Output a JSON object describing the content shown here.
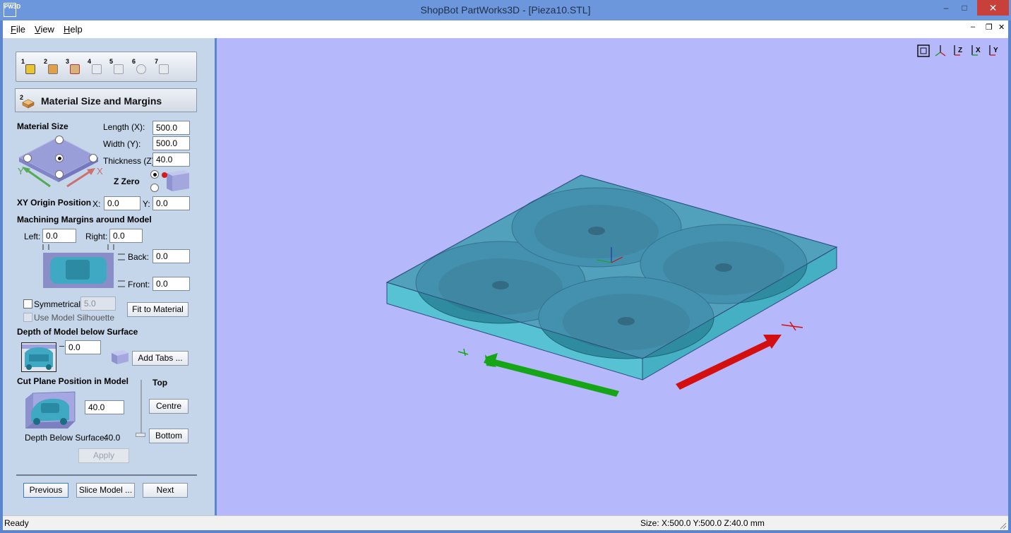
{
  "window": {
    "app_icon_text": "PW3D",
    "title": "ShopBot PartWorks3D - [Pieza10.STL]"
  },
  "menu": {
    "items": [
      {
        "label": "File"
      },
      {
        "label": "View"
      },
      {
        "label": "Help"
      }
    ]
  },
  "toolbar": {
    "steps": [
      {
        "number": "1",
        "icon": "import-model-icon"
      },
      {
        "number": "2",
        "icon": "material-size-icon"
      },
      {
        "number": "3",
        "icon": "roughing-icon"
      },
      {
        "number": "4",
        "icon": "finishing-icon"
      },
      {
        "number": "5",
        "icon": "cutout-icon"
      },
      {
        "number": "6",
        "icon": "preview-icon"
      },
      {
        "number": "7",
        "icon": "save-toolpath-icon"
      }
    ]
  },
  "section": {
    "step_number": "2",
    "title": "Material Size and Margins"
  },
  "material_size": {
    "heading": "Material Size",
    "axis_x": "X",
    "axis_y": "Y",
    "length_label": "Length (X):",
    "length_value": "500.0",
    "width_label": "Width (Y):",
    "width_value": "500.0",
    "thickness_label": "Thickness (Z):",
    "thickness_value": "40.0",
    "z_zero_label": "Z Zero"
  },
  "xy_origin": {
    "heading": "XY Origin Position",
    "x_label": "X:",
    "x_value": "0.0",
    "y_label": "Y:",
    "y_value": "0.0"
  },
  "margins": {
    "heading": "Machining Margins around Model",
    "left_label": "Left:",
    "left_value": "0.0",
    "right_label": "Right:",
    "right_value": "0.0",
    "back_label": "Back:",
    "back_value": "0.0",
    "front_label": "Front:",
    "front_value": "0.0",
    "symmetrical_label": "Symmetrical",
    "symmetrical_value": "5.0",
    "silhouette_label": "Use Model Silhouette",
    "fit_button": "Fit to Material"
  },
  "depth": {
    "heading": "Depth of Model below Surface",
    "value": "0.0",
    "add_tabs_button": "Add Tabs ..."
  },
  "cut_plane": {
    "heading": "Cut Plane Position in Model",
    "top_label": "Top",
    "value": "40.0",
    "centre_button": "Centre",
    "bottom_button": "Bottom",
    "depth_label": "Depth Below Surface:",
    "depth_value": "40.0",
    "apply_button": "Apply"
  },
  "navigation": {
    "previous": "Previous",
    "slice": "Slice Model ...",
    "next": "Next"
  },
  "view_buttons": [
    {
      "icon": "zoom-extents-icon",
      "label": ""
    },
    {
      "icon": "iso-view-icon",
      "label": ""
    },
    {
      "icon": "view-z-icon",
      "label": "Z"
    },
    {
      "icon": "view-x-icon",
      "label": "X"
    },
    {
      "icon": "view-y-icon",
      "label": "Y"
    }
  ],
  "status": {
    "state": "Ready",
    "size": "Size: X:500.0 Y:500.0 Z:40.0 mm"
  },
  "colors": {
    "titlebar": "#6d97dc",
    "panel": "#c5d5ea",
    "viewport": "#b5b8fb",
    "model": "#4ab3c8",
    "x_axis": "#d40f0f",
    "y_axis": "#16a516"
  }
}
